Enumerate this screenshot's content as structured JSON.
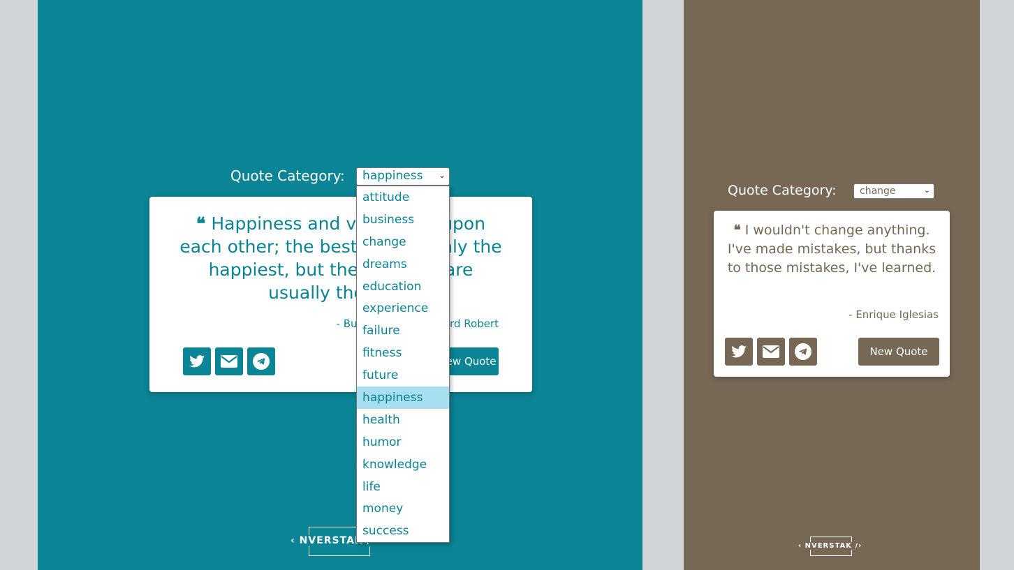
{
  "left": {
    "category_label": "Quote Category:",
    "selected_category": "happiness",
    "quote_mark": "❝",
    "quote": "Happiness and virtue rest upon each other; the best are not only the happiest, but the happiest are usually the best.",
    "author": "- Bulwer-Lytton, Edward Robert",
    "new_quote_label": "New Quote",
    "logo": "‹ NVERSTAK /›",
    "dropdown_options": [
      "attitude",
      "business",
      "change",
      "dreams",
      "education",
      "experience",
      "failure",
      "fitness",
      "future",
      "happiness",
      "health",
      "humor",
      "knowledge",
      "life",
      "money",
      "success"
    ],
    "colors": {
      "theme": "#0b8495",
      "highlight": "#a7dff0"
    }
  },
  "right": {
    "category_label": "Quote Category:",
    "selected_category": "change",
    "quote_mark": "❝",
    "quote": "I wouldn't change anything. I've made mistakes, but thanks to those mistakes, I've learned.",
    "author": "- Enrique Iglesias",
    "new_quote_label": "New Quote",
    "logo": "‹ NVERSTAK /›",
    "colors": {
      "theme": "#776856"
    }
  },
  "icons": [
    "twitter-icon",
    "envelope-icon",
    "telegram-icon",
    "chevron-down-icon",
    "quote-left-icon"
  ]
}
